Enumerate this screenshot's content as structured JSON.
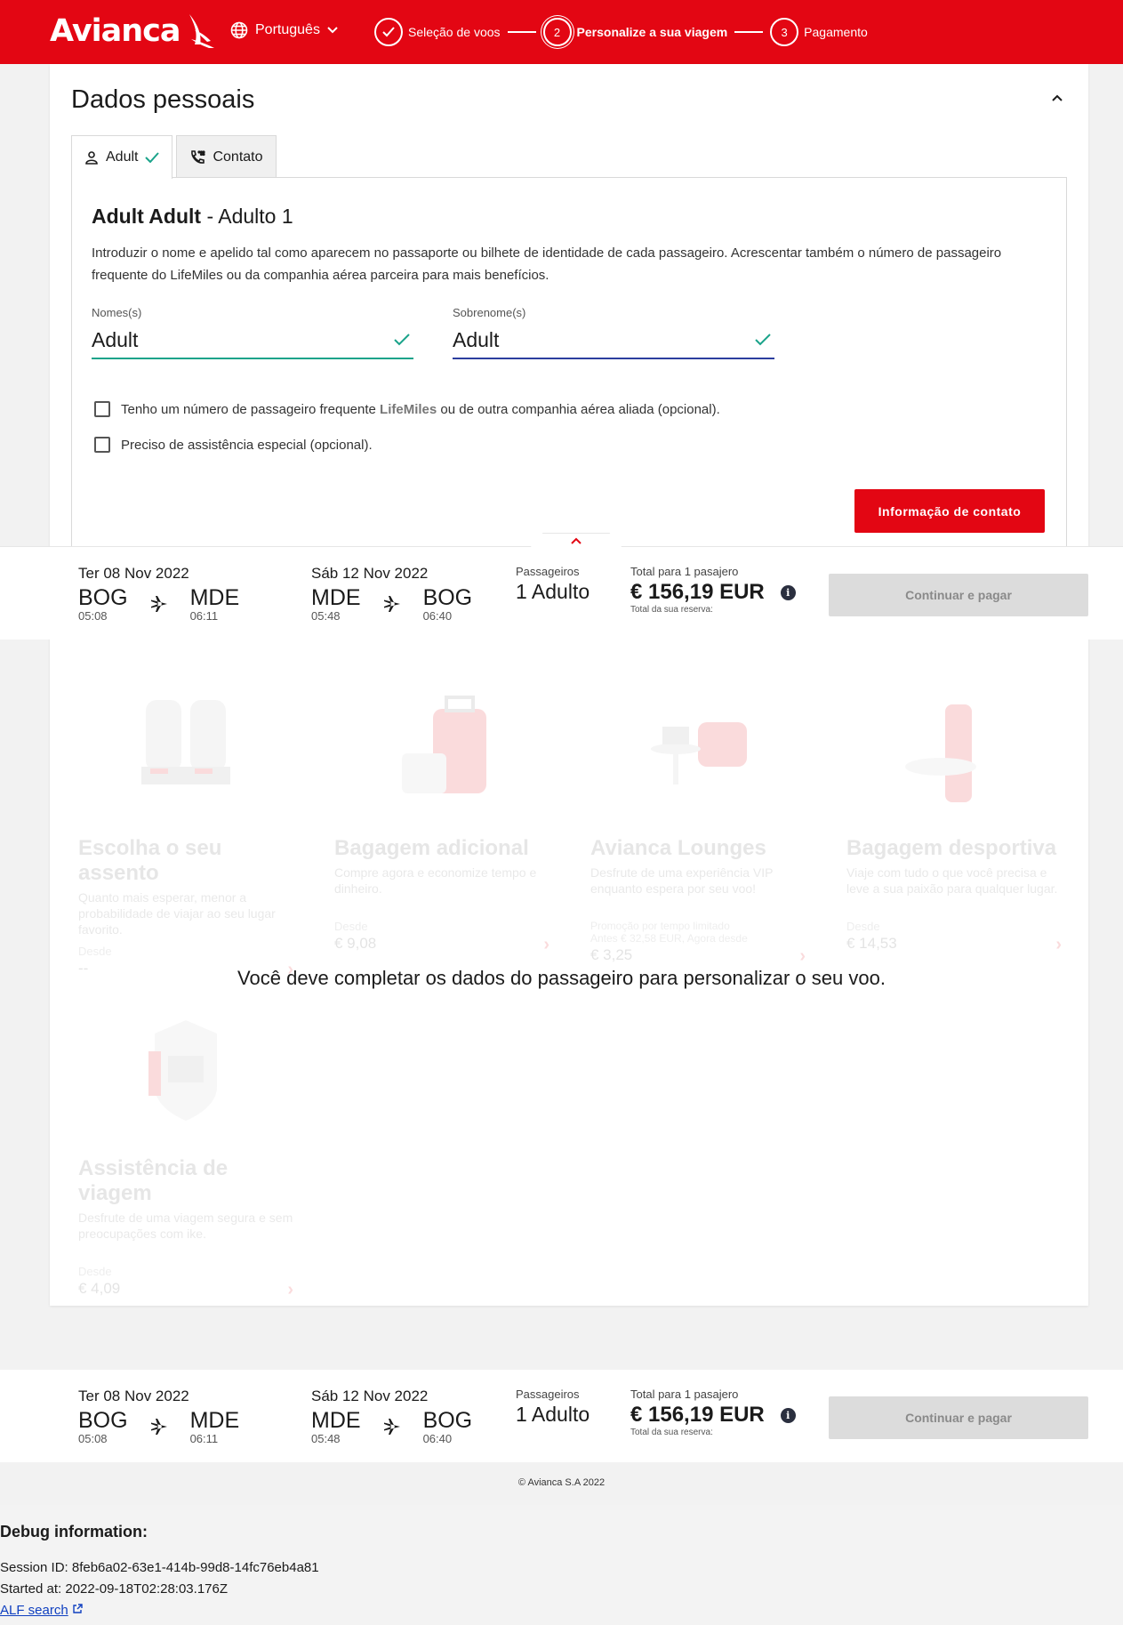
{
  "header": {
    "logo_text": "Avianca",
    "language": "Português",
    "steps": [
      {
        "number": "",
        "label": "Seleção de voos",
        "state": "done"
      },
      {
        "number": "2",
        "label": "Personalize a sua viagem",
        "state": "active"
      },
      {
        "number": "3",
        "label": "Pagamento",
        "state": "upcoming"
      }
    ]
  },
  "personal_data": {
    "title": "Dados pessoais",
    "tabs": [
      {
        "label": "Adult",
        "icon": "person-icon",
        "checked": true
      },
      {
        "label": "Contato",
        "icon": "phone-icon",
        "checked": false
      }
    ],
    "passenger_name": "Adult Adult",
    "passenger_suffix": " - Adulto 1",
    "intro": "Introduzir o nome e apelido tal como aparecem no passaporte ou bilhete de identidade de cada passageiro. Acrescentar também o número de passageiro frequente do LifeMiles ou da companhia aérea parceira para mais benefícios.",
    "fields": {
      "first_name": {
        "label": "Nomes(s)",
        "value": "Adult"
      },
      "last_name": {
        "label": "Sobrenome(s)",
        "value": "Adult"
      }
    },
    "checkboxes": {
      "frequent_flyer_pre": "Tenho um número de passageiro frequente ",
      "frequent_flyer_brand": "LifeMiles",
      "frequent_flyer_post": " ou de outra companhia aérea aliada (opcional).",
      "special_assistance": "Preciso de assistência especial (opcional)."
    },
    "contact_button": "Informação de contato"
  },
  "summary": {
    "outbound": {
      "date": "Ter 08 Nov 2022",
      "from": "BOG",
      "from_time": "05:08",
      "to": "MDE",
      "to_time": "06:11"
    },
    "inbound": {
      "date": "Sáb 12 Nov 2022",
      "from": "MDE",
      "from_time": "05:48",
      "to": "BOG",
      "to_time": "06:40"
    },
    "passengers_label": "Passageiros",
    "passengers_value": "1 Adulto",
    "total_label": "Total para 1 pasajero",
    "total_value": "€ 156,19 EUR",
    "total_sub": "Total da sua reserva:",
    "pay_button": "Continuar e pagar"
  },
  "ancillaries": [
    {
      "title": "Escolha o seu assento",
      "desc": "Quanto mais esperar, menor a probabilidade de viajar ao seu lugar favorito.",
      "from": "Desde",
      "amount": "--"
    },
    {
      "title": "Bagagem adicional",
      "desc": "Compre agora e economize tempo e dinheiro.",
      "from": "Desde",
      "amount": "€ 9,08"
    },
    {
      "title": "Avianca Lounges",
      "desc": "Desfrute de uma experiência VIP enquanto espera por seu voo!",
      "promo": "Promoção por tempo limitado",
      "promo2": "Antes € 32,58 EUR, Agora desde",
      "amount": "€ 3,25"
    },
    {
      "title": "Bagagem desportiva",
      "desc": "Viaje com tudo o que você precisa e leve a sua paixão para qualquer lugar.",
      "from": "Desde",
      "amount": "€ 14,53"
    },
    {
      "title": "Assistência de viagem",
      "desc": "Desfrute de uma viagem segura e sem preocupações com ike.",
      "from": "Desde",
      "amount": "€ 4,09"
    }
  ],
  "notice": "Você deve completar os dados do passageiro para personalizar o seu voo.",
  "copyright": "© Avianca S.A 2022",
  "debug": {
    "title": "Debug information:",
    "session": "Session ID: 8feb6a02-63e1-414b-99d8-14fc76eb4a81",
    "started": "Started at: 2022-09-18T02:28:03.176Z",
    "link": "ALF search"
  },
  "colors": {
    "brand": "#e30613",
    "success": "#1aa38a",
    "focus": "#2c3e9e"
  }
}
